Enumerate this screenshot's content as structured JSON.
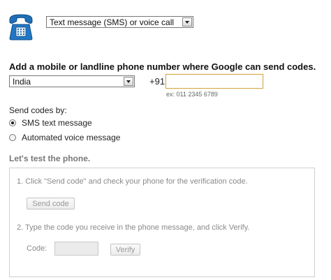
{
  "method": {
    "selected": "Text message (SMS) or voice call"
  },
  "phone_setup": {
    "heading": "Add a mobile or landline phone number where Google can send codes.",
    "country_selected": "India",
    "country_code": "+91",
    "phone_value": "",
    "example": "ex: 011 2345 6789"
  },
  "send_codes": {
    "label": "Send codes by:",
    "options": [
      {
        "label": "SMS text message",
        "checked": true
      },
      {
        "label": "Automated voice message",
        "checked": false
      }
    ]
  },
  "test": {
    "title": "Let's test the phone.",
    "step1": "1. Click \"Send code\" and check your phone for the verification code.",
    "send_code_label": "Send code",
    "step2": "2. Type the code you receive in the phone message, and click Verify.",
    "code_label": "Code:",
    "verify_label": "Verify"
  },
  "colors": {
    "phone_icon": "#1f6fb6",
    "input_focus_border": "#d6a94a",
    "disabled_text": "#8a8a8a"
  },
  "icons": {
    "phone": "phone-icon",
    "dropdown": "chevron-down-icon"
  }
}
